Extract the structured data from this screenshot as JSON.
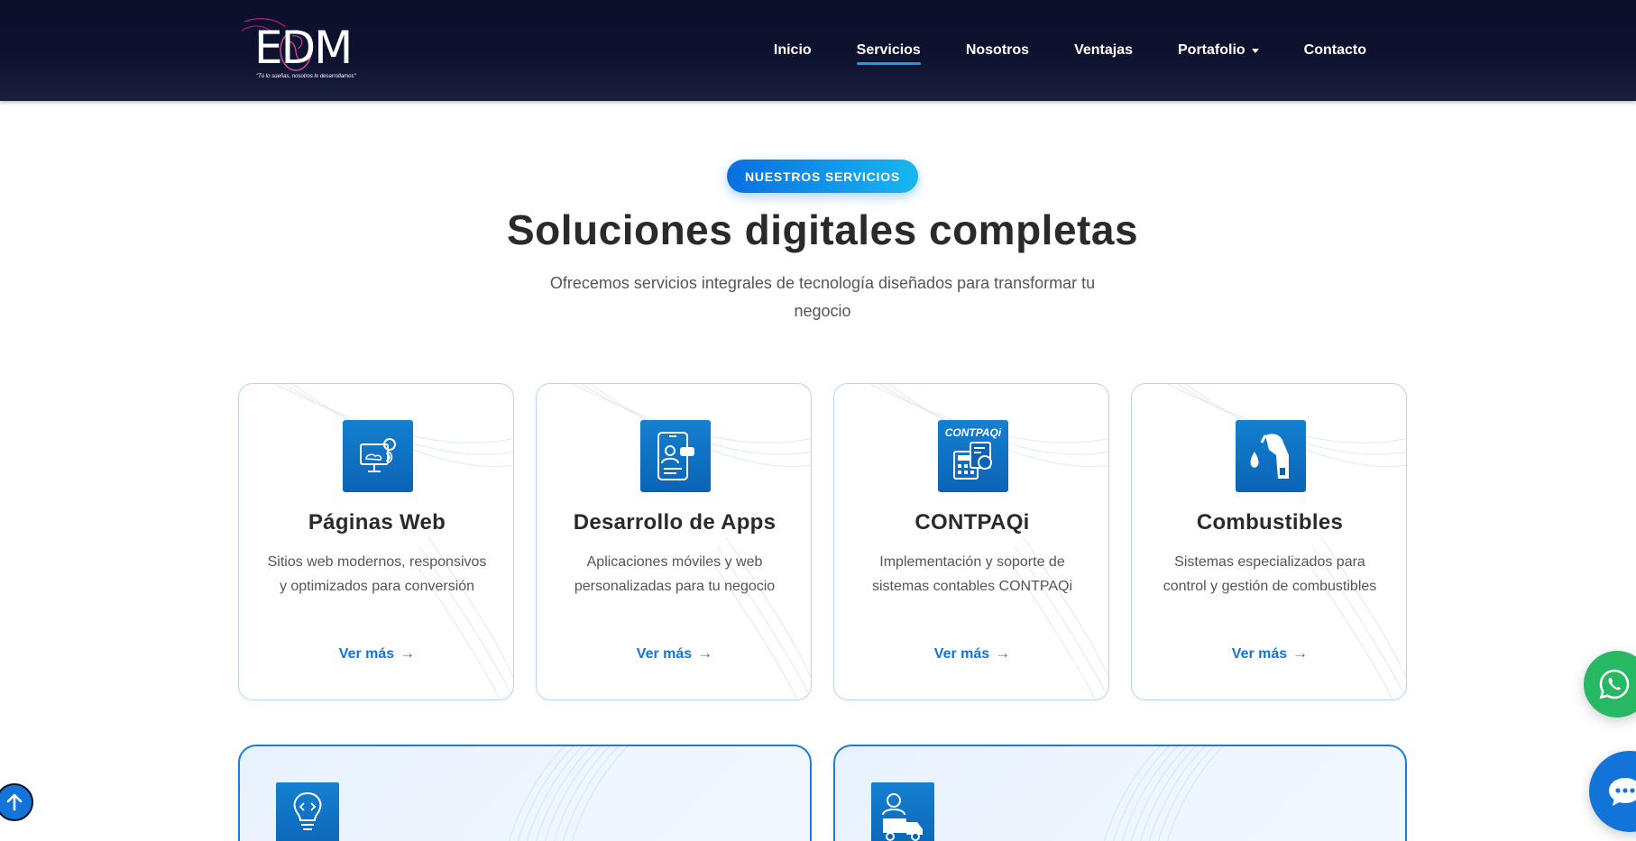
{
  "header": {
    "logo_text": "EDM",
    "logo_tagline": "\"Tú lo sueñas, nosotros lo desarrollamos\"",
    "nav": [
      {
        "label": "Inicio"
      },
      {
        "label": "Servicios",
        "active": true
      },
      {
        "label": "Nosotros"
      },
      {
        "label": "Ventajas"
      },
      {
        "label": "Portafolio",
        "dropdown": true
      },
      {
        "label": "Contacto"
      }
    ]
  },
  "hero": {
    "badge": "NUESTROS SERVICIOS",
    "title": "Soluciones digitales completas",
    "subtitle": "Ofrecemos servicios integrales de tecnología diseñados para transformar tu negocio"
  },
  "services": [
    {
      "icon": "web-development-icon",
      "title": "Páginas Web",
      "description": "Sitios web modernos, responsivos y optimizados para conversión",
      "link": "Ver más"
    },
    {
      "icon": "mobile-app-icon",
      "title": "Desarrollo de Apps",
      "description": "Aplicaciones móviles y web personalizadas para tu negocio",
      "link": "Ver más"
    },
    {
      "icon": "contpaqi-logo-icon",
      "title": "CONTPAQi",
      "description": "Implementación y soporte de sistemas contables CONTPAQi",
      "link": "Ver más"
    },
    {
      "icon": "fuel-pump-icon",
      "title": "Combustibles",
      "description": "Sistemas especializados para control y gestión de combustibles",
      "link": "Ver más"
    }
  ],
  "contpaqi_logo_text": "CONTPAQi",
  "wide_cards": [
    {
      "icon": "lightbulb-code-icon"
    },
    {
      "icon": "delivery-truck-icon"
    }
  ],
  "floating": {
    "scroll_top_icon": "arrow-up-icon",
    "whatsapp_icon": "whatsapp-icon",
    "chat_icon": "chat-bubble-icon"
  },
  "colors": {
    "header_bg": "#0b0f2a",
    "accent": "#1273d8",
    "badge_gradient_start": "#0a6fe0",
    "badge_gradient_end": "#17b7f0",
    "whatsapp": "#27b863"
  }
}
